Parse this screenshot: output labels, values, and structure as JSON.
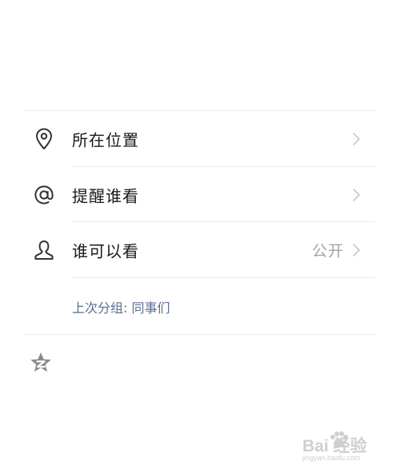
{
  "menu": {
    "items": [
      {
        "label": "所在位置",
        "icon": "location-pin-icon"
      },
      {
        "label": "提醒谁看",
        "icon": "at-sign-icon"
      },
      {
        "label": "谁可以看",
        "icon": "person-icon",
        "value": "公开"
      }
    ],
    "group_hint": "上次分组: 同事们"
  },
  "bottom": {
    "icon": "qzone-star-icon"
  },
  "watermark": {
    "main": "Bai  经验",
    "sub": "jingyan.baidu.com"
  },
  "colors": {
    "text": "#1a1a1a",
    "secondary_text": "#a3a3a3",
    "link": "#5a6e92",
    "divider": "#ececec",
    "icon": "#333333"
  }
}
